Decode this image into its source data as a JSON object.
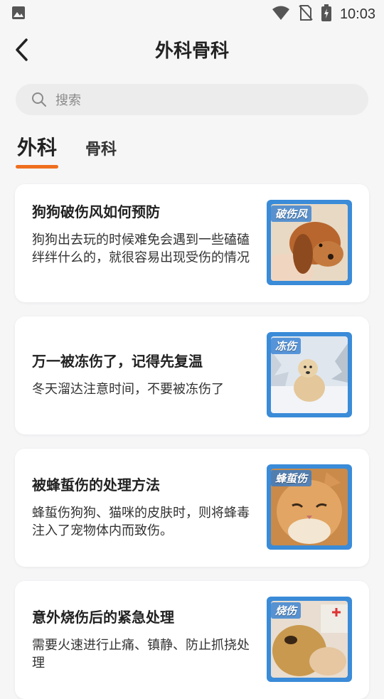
{
  "status_bar": {
    "time": "10:03",
    "icons": [
      "image-icon",
      "wifi-icon",
      "no-sim-icon",
      "battery-icon"
    ]
  },
  "header": {
    "title": "外科骨科",
    "back_icon": "chevron-left-icon"
  },
  "search": {
    "placeholder": "搜索",
    "icon": "search-icon"
  },
  "tabs": [
    {
      "label": "外科",
      "active": true
    },
    {
      "label": "骨科",
      "active": false
    }
  ],
  "accent_color": "#ef6f1f",
  "articles": [
    {
      "title": "狗狗破伤风如何预防",
      "desc": "狗狗出去玩的时候难免会遇到一些磕磕绊绊什么的，就很容易出现受伤的情况",
      "tag": "破伤风"
    },
    {
      "title": "万一被冻伤了，记得先复温",
      "desc": "冬天溜达注意时间，不要被冻伤了",
      "tag": "冻伤"
    },
    {
      "title": "被蜂蜇伤的处理方法",
      "desc": "蜂蜇伤狗狗、猫咪的皮肤时，则将蜂毒注入了宠物体内而致伤。",
      "tag": "蜂蜇伤"
    },
    {
      "title": "意外烧伤后的紧急处理",
      "desc": "需要火速进行止痛、镇静、防止抓挠处理",
      "tag": "烧伤"
    }
  ]
}
